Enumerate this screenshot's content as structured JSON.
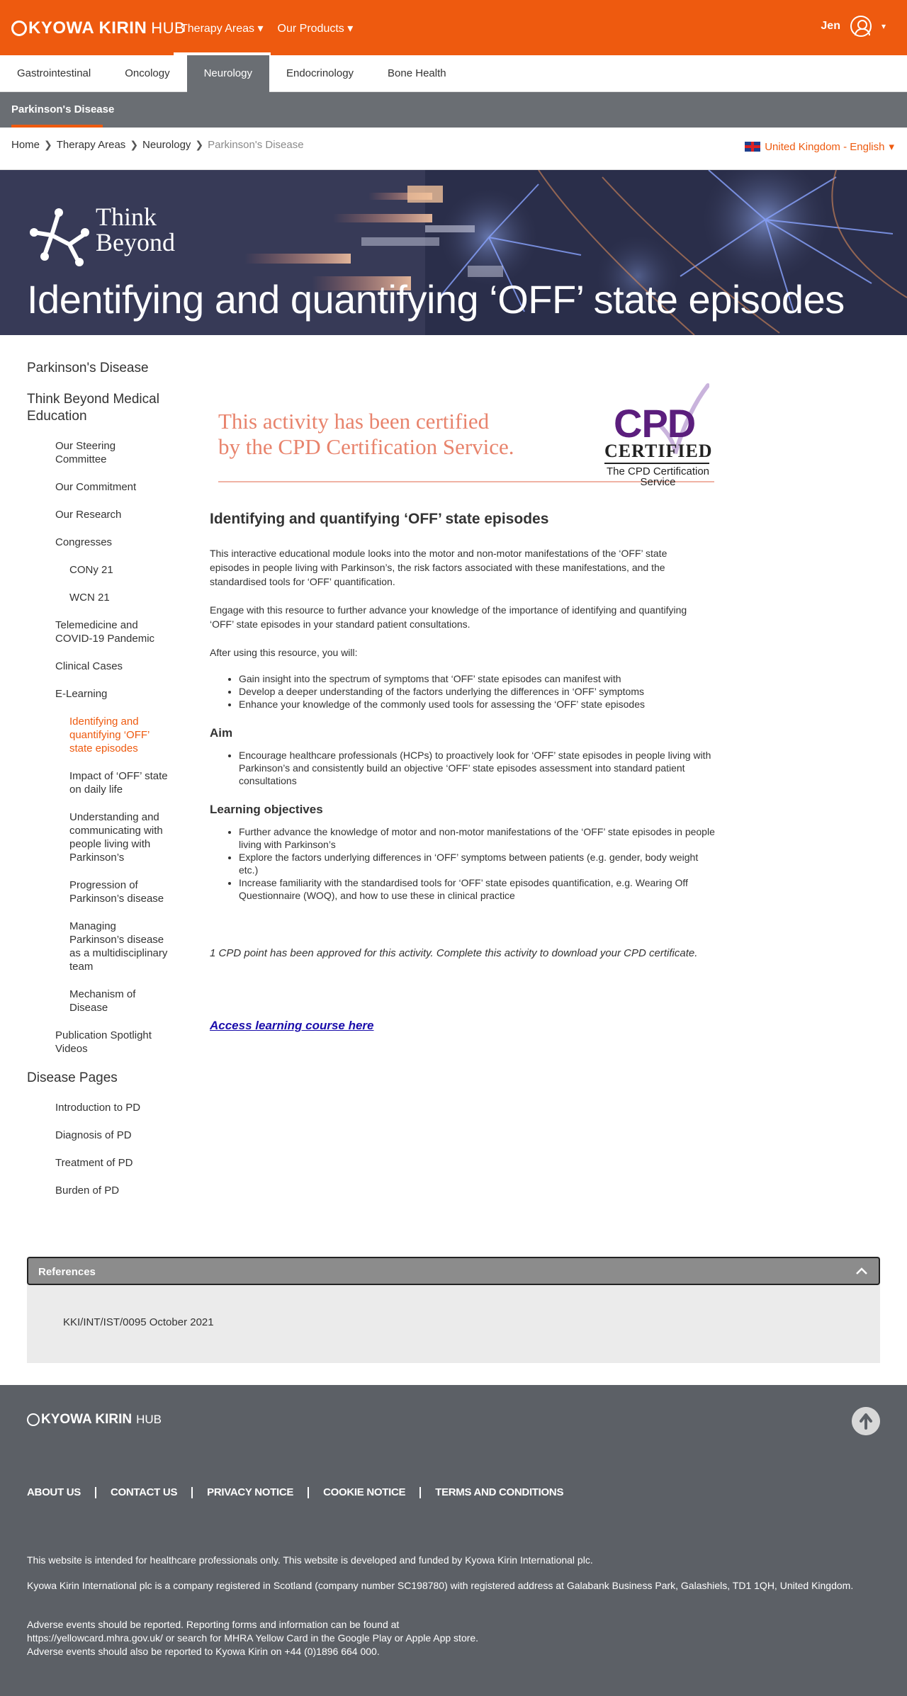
{
  "header": {
    "logo_text": "KYOWA KIRIN",
    "logo_hub": "HUB",
    "nav": [
      {
        "label": "Therapy Areas ▾"
      },
      {
        "label": "Our Products ▾"
      }
    ],
    "user_name": "Jen",
    "user_caret": "▾"
  },
  "therapy_tabs": [
    {
      "label": "Gastrointestinal"
    },
    {
      "label": "Oncology"
    },
    {
      "label": "Neurology"
    },
    {
      "label": "Endocrinology"
    },
    {
      "label": "Bone Health"
    }
  ],
  "subnav": {
    "label": "Parkinson's Disease"
  },
  "breadcrumb": {
    "items": [
      "Home",
      "Therapy Areas",
      "Neurology"
    ],
    "separator": "❯",
    "current": "Parkinson's Disease"
  },
  "locale": {
    "label": "United Kingdom - English",
    "caret": "▾"
  },
  "hero": {
    "brand_line1": "Think",
    "brand_line2": "Beyond",
    "title": "Identifying and quantifying ‘OFF’ state episodes"
  },
  "sidebar": {
    "parkinsons": "Parkinson's Disease",
    "think_beyond": "Think Beyond Medical Education",
    "steering": "Our Steering Committee",
    "commitment": "Our Commitment",
    "research": "Our Research",
    "congresses": "Congresses",
    "cony": "CONy 21",
    "wcn": "WCN 21",
    "telemedicine": "Telemedicine and COVID-19 Pandemic",
    "clinical": "Clinical Cases",
    "elearning": "E-Learning",
    "identifying": "Identifying and quantifying ‘OFF’ state episodes",
    "impact": "Impact of ‘OFF’ state on daily life",
    "understanding": "Understanding and communicating with people living with Parkinson’s",
    "progression": "Progression of Parkinson’s disease",
    "managing": "Managing Parkinson’s disease as a multidisciplinary team",
    "mechanism": "Mechanism of Disease",
    "publication": "Publication Spotlight Videos",
    "disease_pages": "Disease Pages",
    "intro": "Introduction to PD",
    "diagnosis": "Diagnosis of PD",
    "treatment": "Treatment of PD",
    "burden": "Burden of PD"
  },
  "cpd_banner": {
    "text_line1": "This activity has been certified",
    "text_line2": "by the CPD Certification Service.",
    "logo_big": "CPD",
    "logo_certified": "CERTIFIED",
    "logo_service_line1": "The CPD Certification",
    "logo_service_line2": "Service",
    "brand_purple": "#5b1e7d",
    "text_color": "#e8836c"
  },
  "content": {
    "heading": "Identifying and quantifying ‘OFF’ state episodes",
    "intro": "This interactive educational module looks into the motor and non-motor manifestations of the ‘OFF’ state episodes in people living with Parkinson’s, the risk factors associated with these manifestations, and the standardised tools for ‘OFF’ quantification.",
    "engage": "Engage with this resource to further advance your knowledge of the importance of identifying and quantifying ‘OFF’ state episodes in your standard patient consultations.",
    "after": "After using this resource, you will:",
    "outcomes": [
      "Gain insight into the spectrum of symptoms that ‘OFF’ state episodes can manifest with",
      "Develop a deeper understanding of the factors underlying the differences in ‘OFF’ symptoms",
      "Enhance your knowledge of the commonly used tools for assessing the ‘OFF’ state episodes"
    ],
    "aim_heading": "Aim",
    "aim_items": [
      "Encourage healthcare professionals (HCPs) to proactively look for ‘OFF’ state episodes in people living with Parkinson’s and consistently build an objective ‘OFF’ state episodes assessment into standard patient consultations"
    ],
    "objectives_heading": "Learning objectives",
    "objectives": [
      "Further advance the knowledge of motor and non-motor manifestations of the ‘OFF’ state episodes in people living with Parkinson’s",
      "Explore the factors underlying differences in ‘OFF’ symptoms between patients (e.g. gender, body weight etc.)",
      "Increase familiarity with the standardised tools for ‘OFF’ state episodes quantification, e.g. Wearing Off Questionnaire (WOQ), and how to use these in clinical practice"
    ],
    "cpd_note": "1 CPD point has been approved for this activity. Complete this activity to download your CPD certificate.",
    "access_link": "Access learning course here"
  },
  "references": {
    "title": "References",
    "code": "KKI/INT/IST/0095 October 2021"
  },
  "footer": {
    "logo_text": "KYOWA KIRIN",
    "logo_hub": "HUB",
    "links": [
      "ABOUT US",
      "CONTACT US",
      "PRIVACY NOTICE",
      "COOKIE NOTICE",
      "TERMS AND CONDITIONS"
    ],
    "intended": "This website is intended for healthcare professionals only. This website is developed and funded by Kyowa Kirin International plc.",
    "registered": "Kyowa Kirin International plc is a company registered in Scotland (company number SC198780) with registered address at Galabank Business Park, Galashiels, TD1 1QH, United Kingdom.",
    "adverse1": "Adverse events should be reported. Reporting forms and information can be found at",
    "adverse2": "https://yellowcard.mhra.gov.uk/ or search for MHRA Yellow Card in the Google Play or Apple App store.",
    "adverse3": "Adverse events should also be reported to Kyowa Kirin on +44 (0)1896 664 000."
  },
  "colors": {
    "brand_orange": "#ee5a0f",
    "nav_gray": "#6a6e73",
    "footer_gray": "#5c6066",
    "link_blue": "#1a0dab"
  }
}
